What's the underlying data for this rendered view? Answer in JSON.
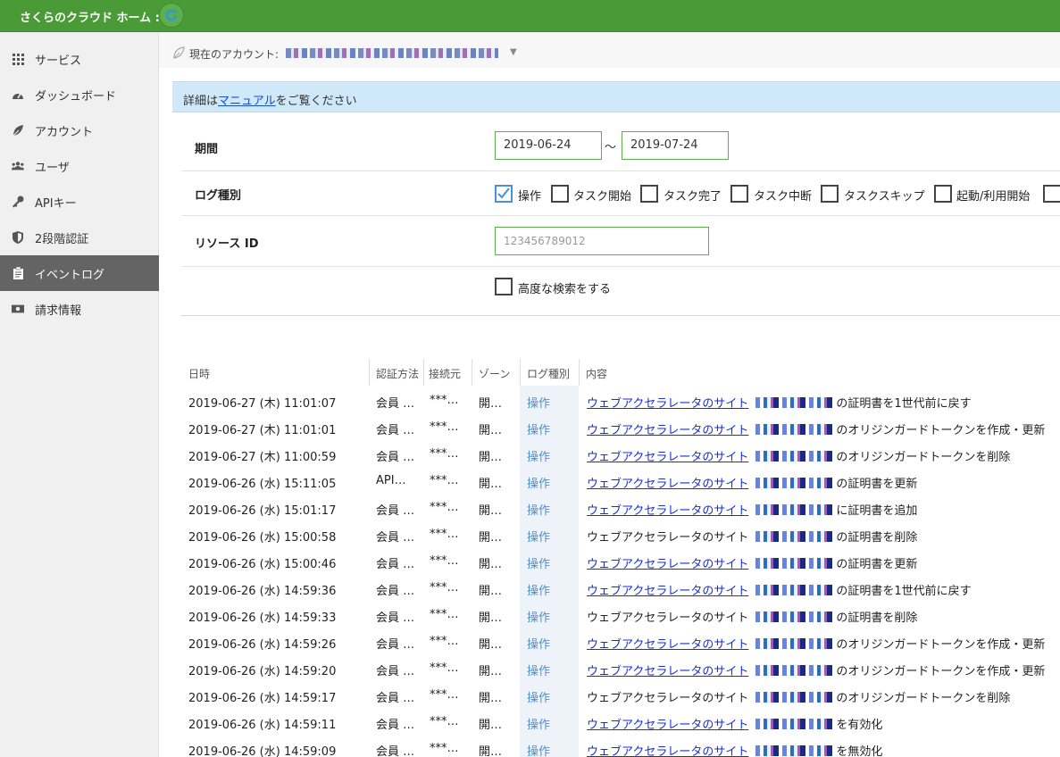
{
  "header": {
    "title": "さくらのクラウド ホーム :"
  },
  "sidebar": {
    "items": [
      {
        "label": "サービス",
        "icon": "grid-icon"
      },
      {
        "label": "ダッシュボード",
        "icon": "dashboard-icon"
      },
      {
        "label": "アカウント",
        "icon": "leaf-icon"
      },
      {
        "label": "ユーザ",
        "icon": "users-icon"
      },
      {
        "label": "APIキー",
        "icon": "key-icon"
      },
      {
        "label": "2段階認証",
        "icon": "shield-icon"
      },
      {
        "label": "イベントログ",
        "icon": "clipboard-icon",
        "active": true
      },
      {
        "label": "請求情報",
        "icon": "money-icon"
      }
    ]
  },
  "account": {
    "label": "現在のアカウント:"
  },
  "notice": {
    "prefix": "詳細は",
    "link": "マニュアル",
    "suffix": "をご覧ください"
  },
  "filters": {
    "period": {
      "label": "期間",
      "from": "2019-06-24",
      "sep": "～",
      "to": "2019-07-24"
    },
    "log_type": {
      "label": "ログ種別",
      "options": [
        {
          "label": "操作",
          "checked": true
        },
        {
          "label": "タスク開始",
          "checked": false
        },
        {
          "label": "タスク完了",
          "checked": false
        },
        {
          "label": "タスク中断",
          "checked": false
        },
        {
          "label": "タスクスキップ",
          "checked": false
        },
        {
          "label": "起動/利用開始",
          "checked": false
        }
      ]
    },
    "resource": {
      "label": "リソース ID",
      "placeholder": "123456789012"
    },
    "advanced": {
      "label": "高度な検索をする",
      "checked": false
    }
  },
  "table": {
    "headers": [
      "日時",
      "認証方法",
      "接続元",
      "ゾーン",
      "ログ種別",
      "内容"
    ],
    "rows": [
      {
        "time": "2019-06-27 (木) 11:01:07",
        "auth": "会員 …",
        "source": "***…",
        "zone": "開…",
        "type": "操作",
        "linked": true,
        "target": "ウェブアクセラレータのサイト",
        "action": "の証明書を1世代前に戻す"
      },
      {
        "time": "2019-06-27 (木) 11:01:01",
        "auth": "会員 …",
        "source": "***…",
        "zone": "開…",
        "type": "操作",
        "linked": true,
        "target": "ウェブアクセラレータのサイト",
        "action": "のオリジンガードトークンを作成・更新"
      },
      {
        "time": "2019-06-27 (木) 11:00:59",
        "auth": "会員 …",
        "source": "***…",
        "zone": "開…",
        "type": "操作",
        "linked": true,
        "target": "ウェブアクセラレータのサイト",
        "action": "のオリジンガードトークンを削除"
      },
      {
        "time": "2019-06-26 (水) 15:11:05",
        "auth": "API…",
        "source": "***…",
        "zone": "開…",
        "type": "操作",
        "linked": true,
        "target": "ウェブアクセラレータのサイト",
        "action": "の証明書を更新"
      },
      {
        "time": "2019-06-26 (水) 15:01:17",
        "auth": "会員 …",
        "source": "***…",
        "zone": "開…",
        "type": "操作",
        "linked": true,
        "target": "ウェブアクセラレータのサイト",
        "action": "に証明書を追加"
      },
      {
        "time": "2019-06-26 (水) 15:00:58",
        "auth": "会員 …",
        "source": "***…",
        "zone": "開…",
        "type": "操作",
        "linked": false,
        "target": "ウェブアクセラレータのサイト",
        "action": "の証明書を削除"
      },
      {
        "time": "2019-06-26 (水) 15:00:46",
        "auth": "会員 …",
        "source": "***…",
        "zone": "開…",
        "type": "操作",
        "linked": true,
        "target": "ウェブアクセラレータのサイト",
        "action": "の証明書を更新"
      },
      {
        "time": "2019-06-26 (水) 14:59:36",
        "auth": "会員 …",
        "source": "***…",
        "zone": "開…",
        "type": "操作",
        "linked": true,
        "target": "ウェブアクセラレータのサイト",
        "action": "の証明書を1世代前に戻す"
      },
      {
        "time": "2019-06-26 (水) 14:59:33",
        "auth": "会員 …",
        "source": "***…",
        "zone": "開…",
        "type": "操作",
        "linked": false,
        "target": "ウェブアクセラレータのサイト",
        "action": "の証明書を削除"
      },
      {
        "time": "2019-06-26 (水) 14:59:26",
        "auth": "会員 …",
        "source": "***…",
        "zone": "開…",
        "type": "操作",
        "linked": true,
        "target": "ウェブアクセラレータのサイト",
        "action": "のオリジンガードトークンを作成・更新"
      },
      {
        "time": "2019-06-26 (水) 14:59:20",
        "auth": "会員 …",
        "source": "***…",
        "zone": "開…",
        "type": "操作",
        "linked": true,
        "target": "ウェブアクセラレータのサイト",
        "action": "のオリジンガードトークンを作成・更新"
      },
      {
        "time": "2019-06-26 (水) 14:59:17",
        "auth": "会員 …",
        "source": "***…",
        "zone": "開…",
        "type": "操作",
        "linked": false,
        "target": "ウェブアクセラレータのサイト",
        "action": "のオリジンガードトークンを削除"
      },
      {
        "time": "2019-06-26 (水) 14:59:11",
        "auth": "会員 …",
        "source": "***…",
        "zone": "開…",
        "type": "操作",
        "linked": true,
        "target": "ウェブアクセラレータのサイト",
        "action": "を有効化"
      },
      {
        "time": "2019-06-26 (水) 14:59:09",
        "auth": "会員 …",
        "source": "***…",
        "zone": "開…",
        "type": "操作",
        "linked": true,
        "target": "ウェブアクセラレータのサイト",
        "action": "を無効化"
      }
    ]
  },
  "colors": {
    "header_green": "#4a9a38",
    "sidebar_active": "#646464",
    "link_blue": "#1a2fd0",
    "input_border": "#5fae4d",
    "notice_bg": "#cfe8fa"
  }
}
